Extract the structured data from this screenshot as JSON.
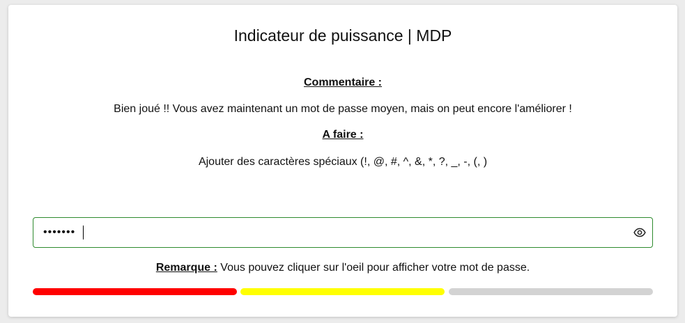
{
  "title": "Indicateur de puissance | MDP",
  "comment": {
    "heading": "Commentaire :",
    "text": "Bien joué !! Vous avez maintenant un mot de passe moyen, mais on peut encore l'améliorer !"
  },
  "todo": {
    "heading": "A faire :",
    "text": "Ajouter des caractères spéciaux (!, @, #, ^, &, *, ?, _, -, (, )"
  },
  "password": {
    "masked_value": "•••••••",
    "visibility_icon": "eye-icon"
  },
  "remark": {
    "label": "Remarque :",
    "text": " Vous pouvez cliquer sur l'oeil pour afficher votre mot de passe."
  },
  "strength": {
    "level": 2,
    "max_level": 3,
    "colors": [
      "#ff0000",
      "#ffff00",
      "#d3d3d3"
    ]
  },
  "colors": {
    "input_border": "#2e8b2e"
  }
}
